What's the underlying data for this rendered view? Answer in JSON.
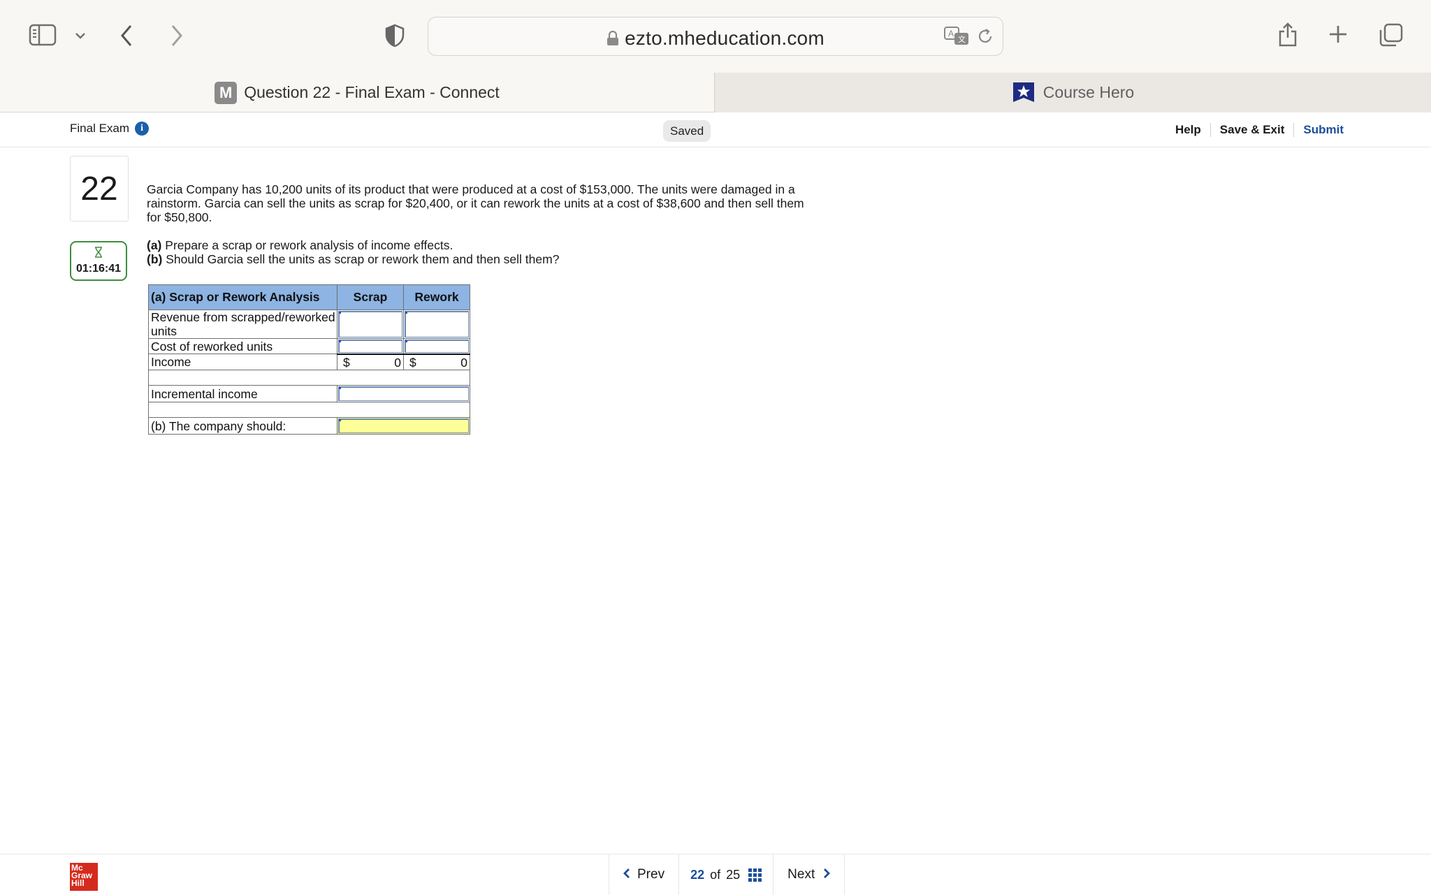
{
  "browser": {
    "url": "ezto.mheducation.com",
    "tabs": [
      {
        "label": "Question 22 - Final Exam - Connect",
        "favicon": "M",
        "active": true
      },
      {
        "label": "Course Hero",
        "favicon": "course-hero-star",
        "active": false
      }
    ]
  },
  "header": {
    "exam_title": "Final Exam",
    "saved_label": "Saved",
    "help": "Help",
    "save_exit": "Save & Exit",
    "submit": "Submit"
  },
  "question": {
    "number": "22",
    "timer": "01:16:41",
    "text": "Garcia Company has 10,200 units of its product that were produced at a cost of $153,000. The units were damaged in a rainstorm. Garcia can sell the units as scrap for $20,400, or it can rework the units at a cost of $38,600 and then sell them for $50,800.",
    "part_a_label": "(a)",
    "part_a_text": "Prepare a scrap or rework analysis of income effects.",
    "part_b_label": "(b)",
    "part_b_text": "Should Garcia sell the units as scrap or rework them and then sell them?"
  },
  "worksheet": {
    "header_label": "(a) Scrap or Rework Analysis",
    "col_scrap": "Scrap",
    "col_rework": "Rework",
    "row_revenue": "Revenue from scrapped/reworked units",
    "row_cost": "Cost of reworked units",
    "row_income": "Income",
    "currency": "$",
    "income_scrap": "0",
    "income_rework": "0",
    "row_incremental": "Incremental income",
    "row_company_should": "(b) The company should:"
  },
  "footer": {
    "logo_text": "Mc Graw Hill",
    "prev": "Prev",
    "current_page": "22",
    "of": "of",
    "total_pages": "25",
    "next": "Next"
  },
  "colors": {
    "accent_blue": "#1c4f9c",
    "table_header": "#8db4e2",
    "timer_green": "#3e8e3e",
    "answer_yellow": "#ffff99",
    "logo_red": "#d52b1e"
  }
}
